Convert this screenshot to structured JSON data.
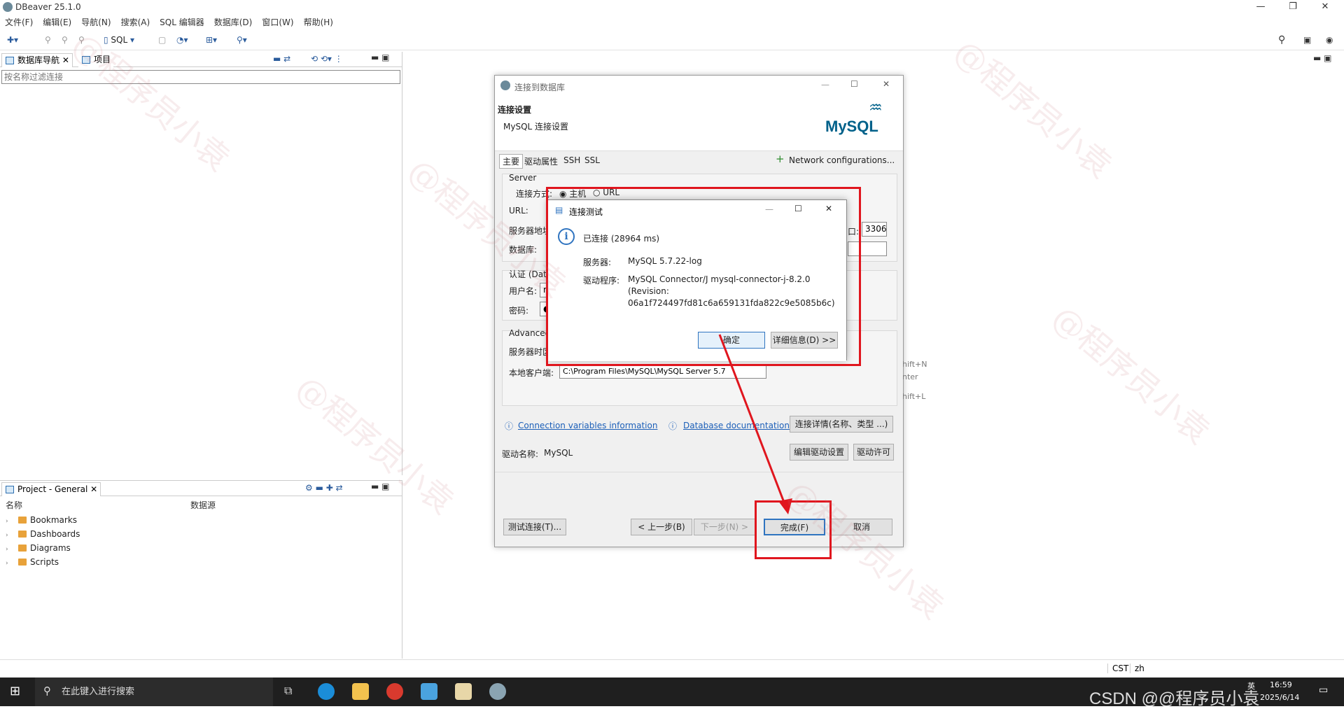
{
  "app": {
    "title": "DBeaver 25.1.0"
  },
  "menu": [
    "文件(F)",
    "编辑(E)",
    "导航(N)",
    "搜索(A)",
    "SQL 编辑器",
    "数据库(D)",
    "窗口(W)",
    "帮助(H)"
  ],
  "toolbar": {
    "sql_label": "SQL"
  },
  "navigator": {
    "tab_db": "数据库导航",
    "tab_project": "项目",
    "filter_placeholder": "按名称过滤连接"
  },
  "project": {
    "tab": "Project - General",
    "col_name": "名称",
    "col_source": "数据源",
    "items": [
      "Bookmarks",
      "Dashboards",
      "Diagrams",
      "Scripts"
    ]
  },
  "connect_dialog": {
    "title": "连接到数据库",
    "header_title": "连接设置",
    "header_sub": "MySQL 连接设置",
    "logo": "MySQL",
    "tabs": [
      "主要",
      "驱动属性",
      "SSH",
      "SSL"
    ],
    "network_config": "Network configurations...",
    "server_group": "Server",
    "connect_by": "连接方式:",
    "radio_host": "主机",
    "radio_url": "URL",
    "url_label": "URL:",
    "host_label": "服务器地址",
    "port_label": "口:",
    "port_value": "3306",
    "db_label": "数据库:",
    "auth_group": "认证 (Dat",
    "user_label": "用户名:",
    "user_value": "r",
    "pass_label": "密码:",
    "pass_value": "●",
    "advanced_group": "Advanced",
    "timezone_label": "服务器时区",
    "client_label": "本地客户端:",
    "client_value": "C:\\Program Files\\MySQL\\MySQL Server 5.7",
    "side_hint_1": "hift+N",
    "side_hint_2": "nter",
    "side_hint_3": "hift+L",
    "link_conn_vars": "Connection variables information",
    "link_db_doc": "Database documentation",
    "btn_conn_details": "连接详情(名称、类型 ...)",
    "driver_name_label": "驱动名称:",
    "driver_name_value": "MySQL",
    "btn_edit_driver": "编辑驱动设置",
    "btn_driver_license": "驱动许可",
    "btn_test": "测试连接(T)...",
    "btn_prev": "< 上一步(B)",
    "btn_next": "下一步(N) >",
    "btn_finish": "完成(F)",
    "btn_cancel": "取消"
  },
  "test_dialog": {
    "title": "连接测试",
    "status": "已连接 (28964 ms)",
    "server_label": "服务器:",
    "server_value": "MySQL 5.7.22-log",
    "driver_label": "驱动程序:",
    "driver_line1": "MySQL Connector/J mysql-connector-j-8.2.0",
    "driver_line2": "(Revision:",
    "driver_line3": "06a1f724497fd81c6a659131fda822c9e5085b6c)",
    "btn_ok": "确定",
    "btn_details": "详细信息(D) >>"
  },
  "status": {
    "tz": "CST",
    "lang": "zh"
  },
  "taskbar": {
    "search_placeholder": "在此键入进行搜索",
    "time": "16:59",
    "date": "2025/6/14",
    "ime": "英",
    "watermark_text": "CSDN @@程序员小袁"
  },
  "overlay_watermark": "@程序员小袁",
  "colors": {
    "highlight_red": "#e0161e",
    "link_blue": "#1c5fb8"
  }
}
